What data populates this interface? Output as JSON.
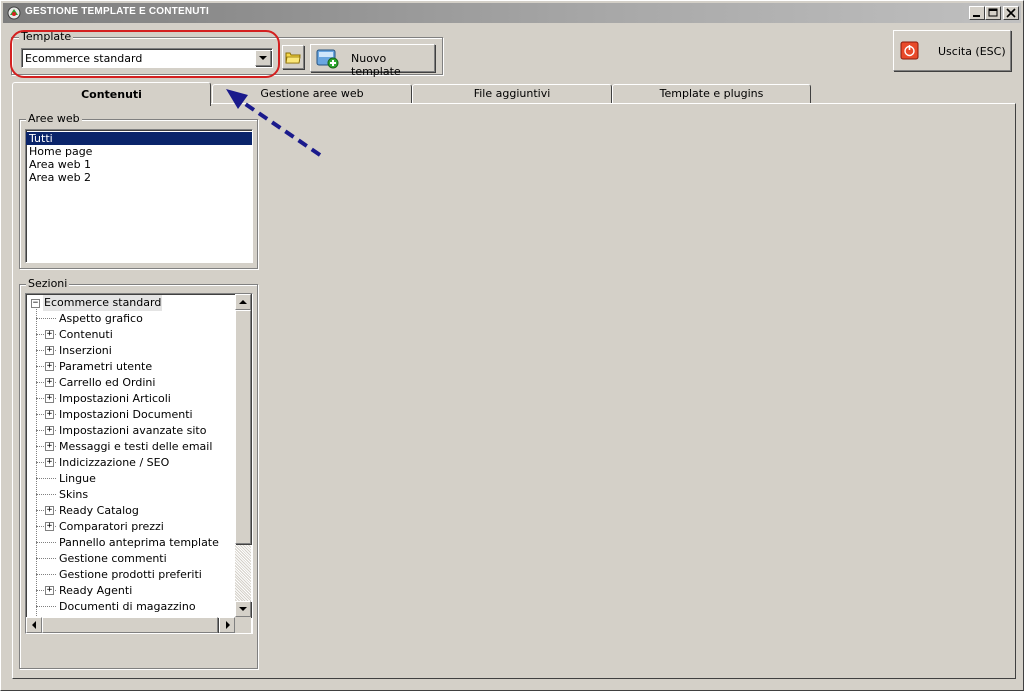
{
  "window": {
    "title": "GESTIONE TEMPLATE E CONTENUTI",
    "controls": {
      "minimize": "_",
      "maximize": "□",
      "close": "×"
    }
  },
  "template_group": {
    "label": "Template",
    "selected_value": "Ecommerce standard",
    "new_template_label": "Nuovo template"
  },
  "exit_button": {
    "label": "Uscita (ESC)"
  },
  "tabs": [
    {
      "label": "Contenuti",
      "active": true
    },
    {
      "label": "Gestione aree web",
      "active": false
    },
    {
      "label": "File aggiuntivi",
      "active": false
    },
    {
      "label": "Template e plugins",
      "active": false
    }
  ],
  "aree_web": {
    "label": "Aree web",
    "items": [
      "Tutti",
      "Home page",
      "Area web 1",
      "Area web 2"
    ],
    "selected_index": 0
  },
  "sezioni": {
    "label": "Sezioni",
    "root": "Ecommerce standard",
    "nodes": [
      {
        "label": "Aspetto grafico",
        "expandable": false
      },
      {
        "label": "Contenuti",
        "expandable": true
      },
      {
        "label": "Inserzioni",
        "expandable": true
      },
      {
        "label": "Parametri utente",
        "expandable": true
      },
      {
        "label": "Carrello ed Ordini",
        "expandable": true
      },
      {
        "label": "Impostazioni Articoli",
        "expandable": true
      },
      {
        "label": "Impostazioni Documenti",
        "expandable": true
      },
      {
        "label": "Impostazioni avanzate sito",
        "expandable": true
      },
      {
        "label": "Messaggi e testi delle email",
        "expandable": true
      },
      {
        "label": "Indicizzazione / SEO",
        "expandable": true
      },
      {
        "label": "Lingue",
        "expandable": false
      },
      {
        "label": "Skins",
        "expandable": false
      },
      {
        "label": "Ready Catalog",
        "expandable": true
      },
      {
        "label": "Comparatori prezzi",
        "expandable": true
      },
      {
        "label": "Pannello anteprima template",
        "expandable": false
      },
      {
        "label": "Gestione commenti",
        "expandable": false
      },
      {
        "label": "Gestione prodotti preferiti",
        "expandable": false
      },
      {
        "label": "Ready Agenti",
        "expandable": true
      },
      {
        "label": "Documenti di magazzino",
        "expandable": false
      }
    ]
  },
  "colors": {
    "selection": "#0a246a",
    "annotation_ellipse": "#d42020",
    "annotation_arrow": "#1a1a8c",
    "face": "#d4d0c8"
  },
  "icons": {
    "app": "app-icon",
    "folder": "folder-icon",
    "new_template": "new-template-icon",
    "exit": "power-icon"
  }
}
